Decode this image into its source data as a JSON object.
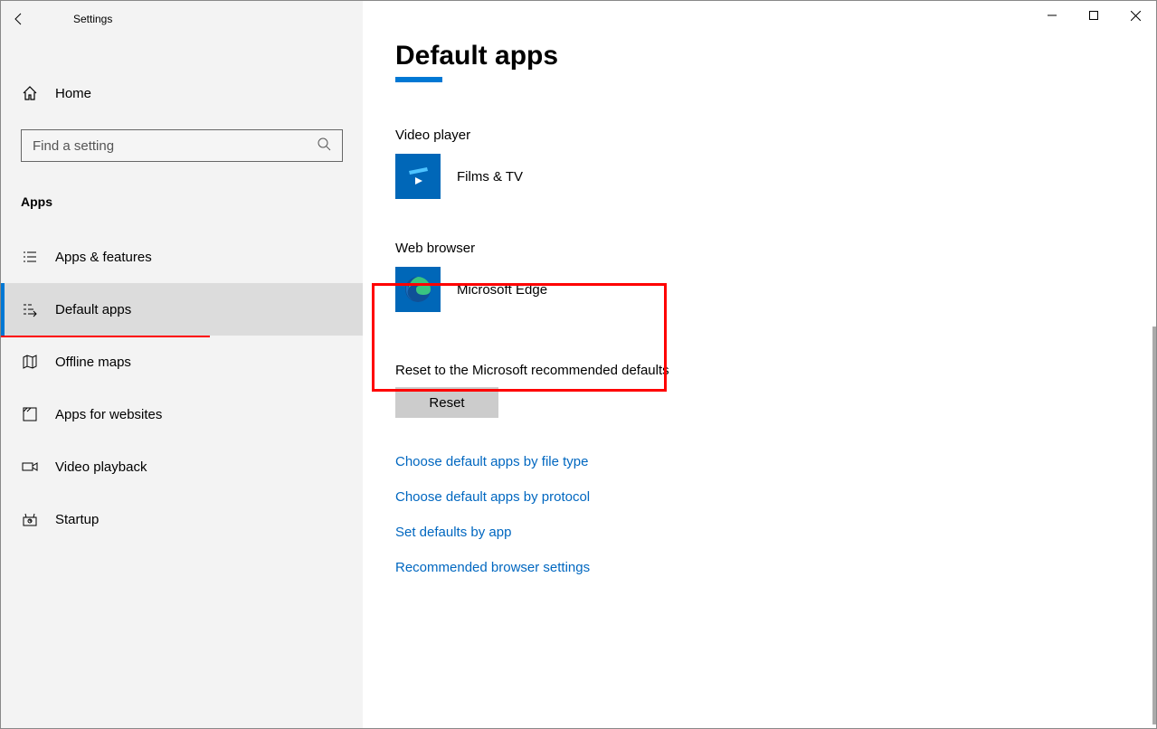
{
  "window": {
    "title": "Settings"
  },
  "sidebar": {
    "home_label": "Home",
    "search_placeholder": "Find a setting",
    "section": "Apps",
    "items": [
      {
        "label": "Apps & features"
      },
      {
        "label": "Default apps"
      },
      {
        "label": "Offline maps"
      },
      {
        "label": "Apps for websites"
      },
      {
        "label": "Video playback"
      },
      {
        "label": "Startup"
      }
    ]
  },
  "main": {
    "title": "Default apps",
    "video_player": {
      "label": "Video player",
      "app": "Films & TV"
    },
    "web_browser": {
      "label": "Web browser",
      "app": "Microsoft Edge"
    },
    "reset": {
      "label": "Reset to the Microsoft recommended defaults",
      "button": "Reset"
    },
    "links": [
      "Choose default apps by file type",
      "Choose default apps by protocol",
      "Set defaults by app",
      "Recommended browser settings"
    ]
  }
}
